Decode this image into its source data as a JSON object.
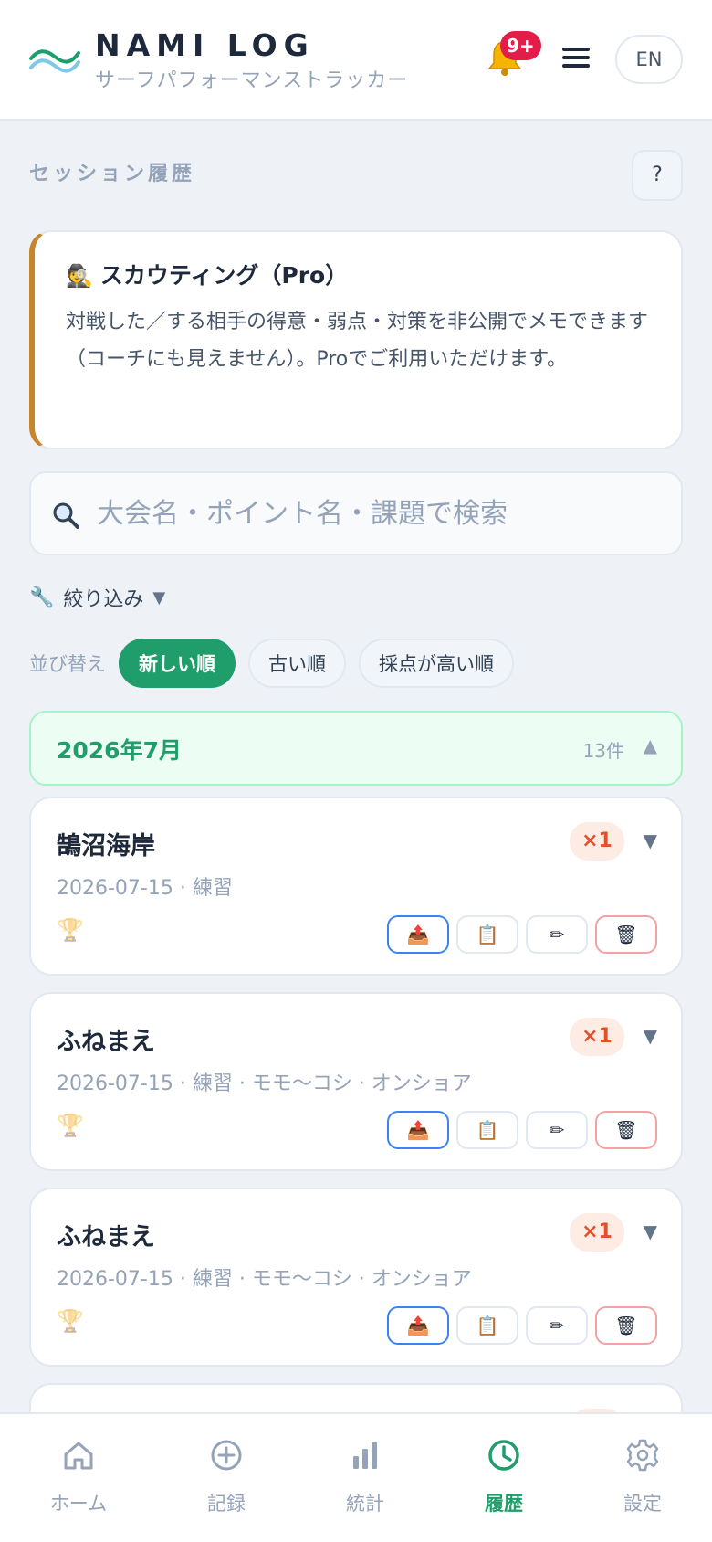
{
  "app": {
    "title": "NAMI LOG",
    "subtitle": "サーフパフォーマンストラッカー",
    "notification_badge": "9+",
    "language": "EN"
  },
  "section": {
    "title": "セッション履歴",
    "help_label": "?"
  },
  "scouting": {
    "icon": "🕵",
    "title": "スカウティング（Pro）",
    "description": "対戦した／する相手の得意・弱点・対策を非公開でメモできます（コーチにも見えません）。Proでご利用いただけます。"
  },
  "search": {
    "placeholder": "大会名・ポイント名・課題で検索"
  },
  "filter": {
    "label": "絞り込み",
    "caret": "▼"
  },
  "sort": {
    "label": "並び替え",
    "options": [
      "新しい順",
      "古い順",
      "採点が高い順"
    ],
    "active": "新しい順"
  },
  "month_group": {
    "title": "2026年7月",
    "count": "13件",
    "caret": "▲"
  },
  "sessions": [
    {
      "name": "鵠沼海岸",
      "meta": "2026-07-15 · 練習",
      "multiplier": "×1"
    },
    {
      "name": "ふねまえ",
      "meta": "2026-07-15 · 練習 · モモ〜コシ · オンショア",
      "multiplier": "×1"
    },
    {
      "name": "ふねまえ",
      "meta": "2026-07-15 · 練習 · モモ〜コシ · オンショア",
      "multiplier": "×1"
    }
  ],
  "session_actions": {
    "share": "📤",
    "copy": "📋",
    "edit": "✏",
    "delete": "🗑"
  },
  "bottom_nav": {
    "items": [
      "ホーム",
      "記録",
      "統計",
      "履歴",
      "設定"
    ],
    "active": "履歴"
  },
  "colors": {
    "accent": "#1f9d6a",
    "scout_border": "#c7862b",
    "badge": "#e11d48"
  }
}
